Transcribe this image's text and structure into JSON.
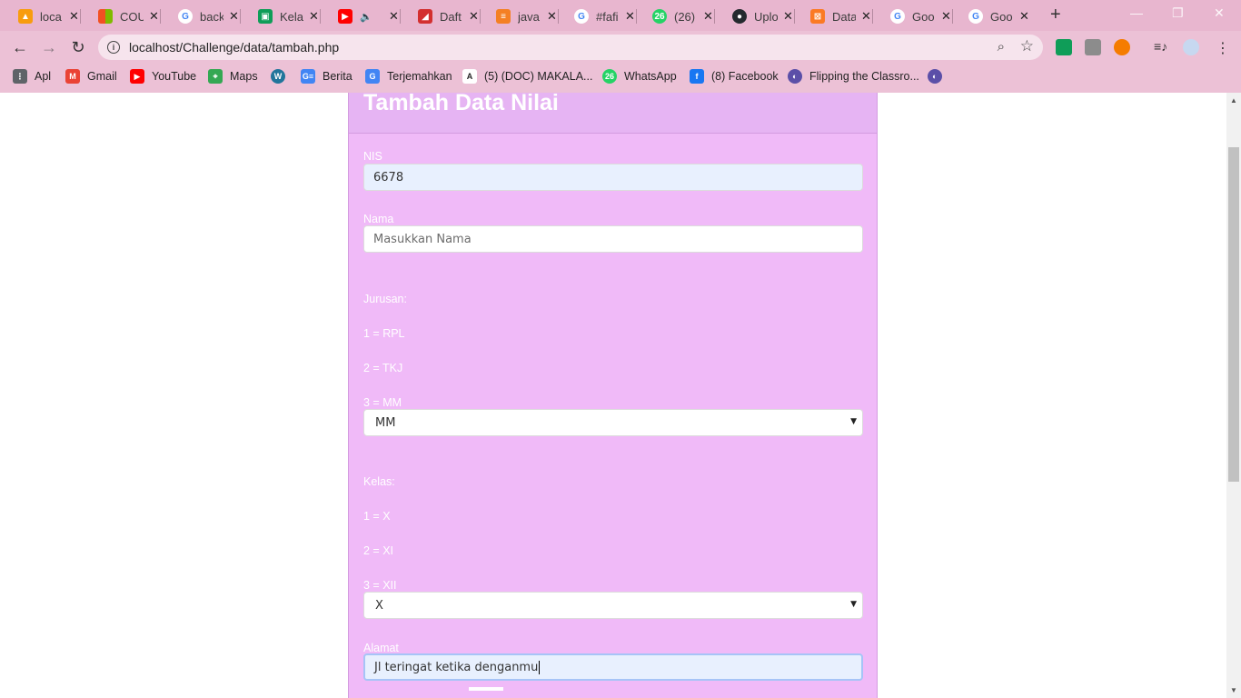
{
  "browser": {
    "tabs": [
      {
        "label": "loca",
        "icon": "pma-icon",
        "color": "#f89c0e"
      },
      {
        "label": "COU",
        "icon": "microsoft-icon",
        "color": "#f25022"
      },
      {
        "label": "back",
        "icon": "google-icon",
        "color": "#4285f4"
      },
      {
        "label": "Kela",
        "icon": "classroom-icon",
        "color": "#0f9d58"
      },
      {
        "label": "",
        "icon": "youtube-icon",
        "color": "#ff0000"
      },
      {
        "label": "Daft",
        "icon": "app-icon",
        "color": "#d32f2f"
      },
      {
        "label": "java",
        "icon": "stackoverflow-icon",
        "color": "#f48024"
      },
      {
        "label": "#fafi",
        "icon": "google-icon",
        "color": "#4285f4"
      },
      {
        "label": "(26)",
        "icon": "whatsapp-icon",
        "color": "#25d366"
      },
      {
        "label": "Uplo",
        "icon": "github-icon",
        "color": "#24292e"
      },
      {
        "label": "Data",
        "icon": "xampp-icon",
        "color": "#fb7a24"
      },
      {
        "label": "Goo",
        "icon": "google-icon",
        "color": "#4285f4"
      },
      {
        "label": "Goo",
        "icon": "google-icon",
        "color": "#4285f4"
      }
    ],
    "new_tab": "+",
    "url": "localhost/Challenge/data/tambah.php",
    "bookmarks": [
      {
        "label": "Apl",
        "icon": "apps-grid-icon",
        "color": "#5f6368"
      },
      {
        "label": "Gmail",
        "icon": "gmail-icon",
        "color": "#ea4335"
      },
      {
        "label": "YouTube",
        "icon": "youtube-icon",
        "color": "#ff0000"
      },
      {
        "label": "Maps",
        "icon": "maps-icon",
        "color": "#34a853"
      },
      {
        "label": "",
        "icon": "wordpress-icon",
        "color": "#21759b"
      },
      {
        "label": "Berita",
        "icon": "news-icon",
        "color": "#4285f4"
      },
      {
        "label": "Terjemahkan",
        "icon": "translate-icon",
        "color": "#4285f4"
      },
      {
        "label": "(5) (DOC) MAKALA...",
        "icon": "academia-icon",
        "color": "#222222"
      },
      {
        "label": "WhatsApp",
        "icon": "whatsapp-icon",
        "color": "#25d366"
      },
      {
        "label": "(8) Facebook",
        "icon": "facebook-icon",
        "color": "#1877f2"
      },
      {
        "label": "Flipping the Classro...",
        "icon": "globe-icon",
        "color": "#5b4fa8"
      },
      {
        "label": "",
        "icon": "globe-icon",
        "color": "#5b4fa8"
      }
    ]
  },
  "form": {
    "title": "Tambah Data Nilai",
    "nis_label": "NIS",
    "nis_value": "6678",
    "nama_label": "Nama",
    "nama_placeholder": "Masukkan Nama",
    "jurusan_label": "Jurusan:",
    "jurusan_options": [
      "1 = RPL",
      "2 = TKJ",
      "3 = MM"
    ],
    "jurusan_selected": "MM",
    "kelas_label": "Kelas:",
    "kelas_options": [
      "1 = X",
      "2 = XI",
      "3 = XII"
    ],
    "kelas_selected": "X",
    "alamat_label": "Alamat",
    "alamat_value": "Jl teringat ketika denganmu"
  },
  "colors": {
    "card_bg": "#f0baf8",
    "card_header_bg": "#e6b4f3",
    "chrome_bg": "#ecc1d6",
    "label_text": "#ffffff",
    "autofill_bg": "#e8f0fe"
  }
}
